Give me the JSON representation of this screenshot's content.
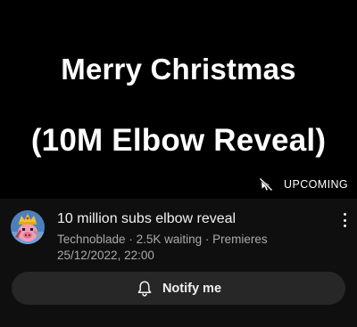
{
  "thumbnail": {
    "line1": "Merry Christmas",
    "line2": "(10M Elbow Reveal)",
    "badge": "UPCOMING",
    "badge_icon": "no-cursor-icon"
  },
  "video": {
    "title": "10 million subs elbow reveal",
    "channel": "Technoblade",
    "sep1": " · ",
    "waiting": "2.5K waiting",
    "sep2": " · ",
    "premieres": "Premieres",
    "datetime": "25/12/2022, 22:00",
    "avatar_icon": "pig-avatar-icon",
    "menu_icon": "more-vert-icon"
  },
  "notify": {
    "label": "Notify me",
    "icon": "bell-icon"
  },
  "colors": {
    "background": "#0f0f0f",
    "thumbnail_bg": "#000000",
    "button_bg": "#272727",
    "secondary_text": "#aaaaaa"
  }
}
